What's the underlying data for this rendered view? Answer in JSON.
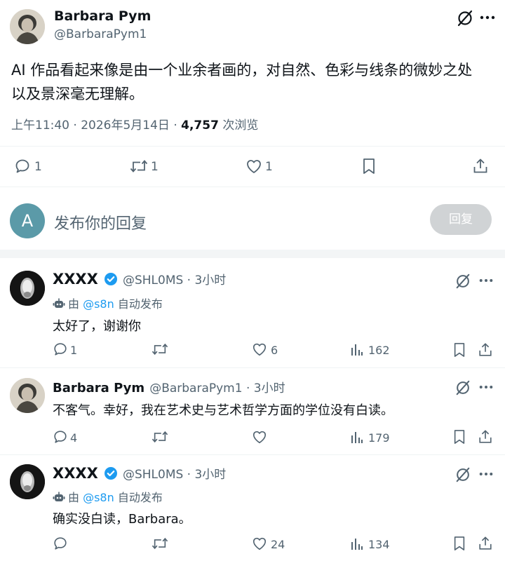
{
  "post": {
    "author_name": "Barbara Pym",
    "author_handle": "@BarbaraPym1",
    "text_line1": "AI 作品看起来像是由一个业余者画的，对自然、色彩与线条的微妙之处",
    "text_line2": "以及景深毫无理解。",
    "time": "上午11:40 · 2026年5月14日 · ",
    "views_count": "4,757",
    "views_label": " 次浏览",
    "reply_count": "1",
    "retweet_count": "1",
    "like_count": "1"
  },
  "composer": {
    "avatar_letter": "A",
    "placeholder": "发布你的回复",
    "reply_button": "回复",
    "avatar_color": "#5b9aa8"
  },
  "replies": [
    {
      "name": "XXXX",
      "handle": "@SHL0MS · 3小时",
      "verified": true,
      "auto_prefix": "由 ",
      "auto_handle": "@s8n",
      "auto_suffix": " 自动发布",
      "text": "太好了，谢谢你",
      "reply_count": "1",
      "retweet_count": "",
      "like_count": "6",
      "views_count": "162"
    },
    {
      "name": "Barbara Pym",
      "handle": "@BarbaraPym1 · 3小时",
      "verified": false,
      "text": "不客气。幸好，我在艺术史与艺术哲学方面的学位没有白读。",
      "reply_count": "4",
      "retweet_count": "",
      "like_count": "",
      "views_count": "179"
    },
    {
      "name": "XXXX",
      "handle": "@SHL0MS · 3小时",
      "verified": true,
      "auto_prefix": "由 ",
      "auto_handle": "@s8n",
      "auto_suffix": " 自动发布",
      "text": "确实没白读，Barbara。",
      "reply_count": "",
      "retweet_count": "",
      "like_count": "24",
      "views_count": "134"
    }
  ],
  "colors": {
    "accent": "#1d9bf0",
    "muted": "#536471",
    "text": "#0f1419",
    "divider": "#eff3f4",
    "reply_button_bg": "#d0d3d5"
  },
  "icons": [
    "grok-icon",
    "more-icon",
    "reply-icon",
    "retweet-icon",
    "like-icon",
    "bookmark-icon",
    "share-icon",
    "views-icon",
    "verified-badge-icon",
    "bot-icon"
  ]
}
